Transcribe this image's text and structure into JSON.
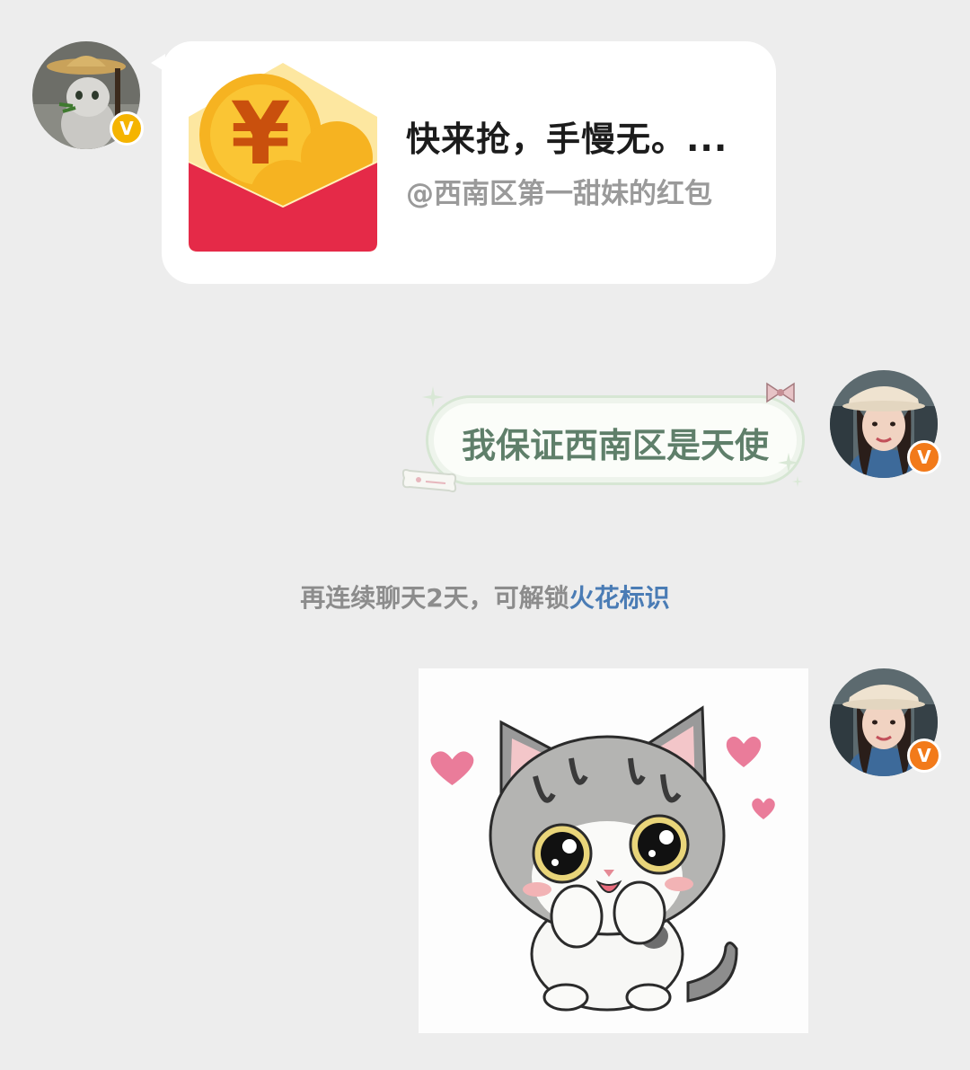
{
  "messages": {
    "red_packet": {
      "title": "快来抢，手慢无。...",
      "subtitle": "@西南区第一甜妹的红包",
      "currency_symbol": "¥",
      "icon": "red-envelope-icon"
    },
    "text_bubble": {
      "text": "我保证西南区是天使"
    },
    "system_notice": {
      "prefix": "再连续聊天2天，可解锁",
      "link": "火花标识"
    },
    "sticker": {
      "icon": "cat-sticker-image"
    }
  },
  "badges": {
    "sender_badge": "V",
    "self_badge": "V"
  },
  "colors": {
    "background": "#ededed",
    "packet_red": "#e52a48",
    "packet_yellow": "#fde7a0",
    "coin": "#f6b321",
    "bubble_text": "#5f7f6a",
    "link": "#4a7cb5",
    "vip_gold": "#f5b400",
    "vip_orange": "#f27a1a"
  }
}
